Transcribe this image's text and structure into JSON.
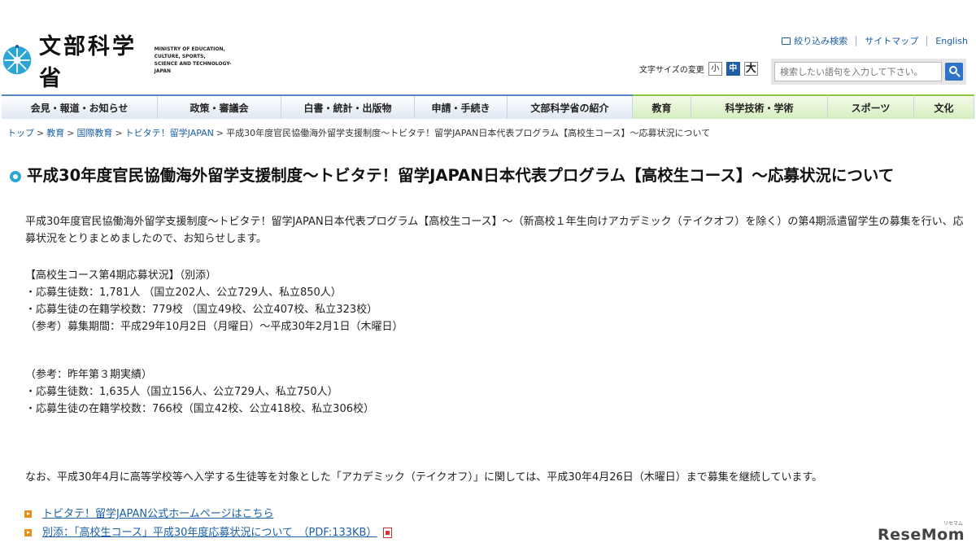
{
  "header": {
    "logo_text": "文部科学省",
    "logo_subtext": "MINISTRY OF EDUCATION,\nCULTURE, SPORTS,\nSCIENCE AND TECHNOLOGY-JAPAN",
    "util_links": {
      "filter_search": "絞り込み検索",
      "sitemap": "サイトマップ",
      "english": "English"
    },
    "font_size": {
      "label": "文字サイズの変更",
      "small": "小",
      "medium": "中",
      "large": "大"
    },
    "search": {
      "placeholder": "検索したい語句を入力して下さい。"
    }
  },
  "nav": {
    "items": [
      "会見・報道・お知らせ",
      "政策・審議会",
      "白書・統計・出版物",
      "申請・手続き",
      "文部科学省の紹介",
      "教育",
      "科学技術・学術",
      "スポーツ",
      "文化"
    ]
  },
  "breadcrumb": {
    "items": [
      "トップ",
      "教育",
      "国際教育",
      "トビタテ！留学JAPAN"
    ],
    "current": "平成30年度官民協働海外留学支援制度～トビタテ！留学JAPAN日本代表プログラム【高校生コース】～応募状況について"
  },
  "main": {
    "title": "平成30年度官民協働海外留学支援制度～トビタテ！留学JAPAN日本代表プログラム【高校生コース】～応募状況について",
    "intro": "平成30年度官民協働海外留学支援制度～トビタテ！留学JAPAN日本代表プログラム【高校生コース】～（新高校１年生向けアカデミック（テイクオフ）を除く）の第4期派遣留学生の募集を行い、応募状況をとりまとめましたので、お知らせします。",
    "current_status": {
      "heading": "【高校生コース第4期応募状況】（別添）",
      "applicants": "・応募生徒数：1,781人 （国立202人、公立729人、私立850人）",
      "schools": "・応募生徒の在籍学校数：779校 （国立49校、公立407校、私立323校）",
      "period": "（参考）募集期間：平成29年10月2日（月曜日）～平成30年2月1日（木曜日）"
    },
    "reference": {
      "heading": "（参考：昨年第３期実績）",
      "applicants": "・応募生徒数：1,635人（国立156人、公立729人、私立750人）",
      "schools": "・応募生徒の在籍学校数：766校（国立42校、公立418校、私立306校）"
    },
    "note": "なお、平成30年4月に高等学校等へ入学する生徒等を対象とした「アカデミック（テイクオフ）」に関しては、平成30年4月26日（木曜日）まで募集を継続しています。",
    "links": {
      "homepage": "トビタテ！留学JAPAN公式ホームページはこちら",
      "attachment": "別添：「高校生コース」平成30年度応募状況について　（PDF:133KB）"
    }
  },
  "watermark": {
    "text": "ReseMom",
    "sub": "リセマム"
  },
  "colors": {
    "accent_blue": "#1e5fa6",
    "link_blue": "#1a5fa8",
    "nav_green": "#8cc63f",
    "title_icon": "#2aa6d6",
    "bullet_orange": "#e69019"
  }
}
